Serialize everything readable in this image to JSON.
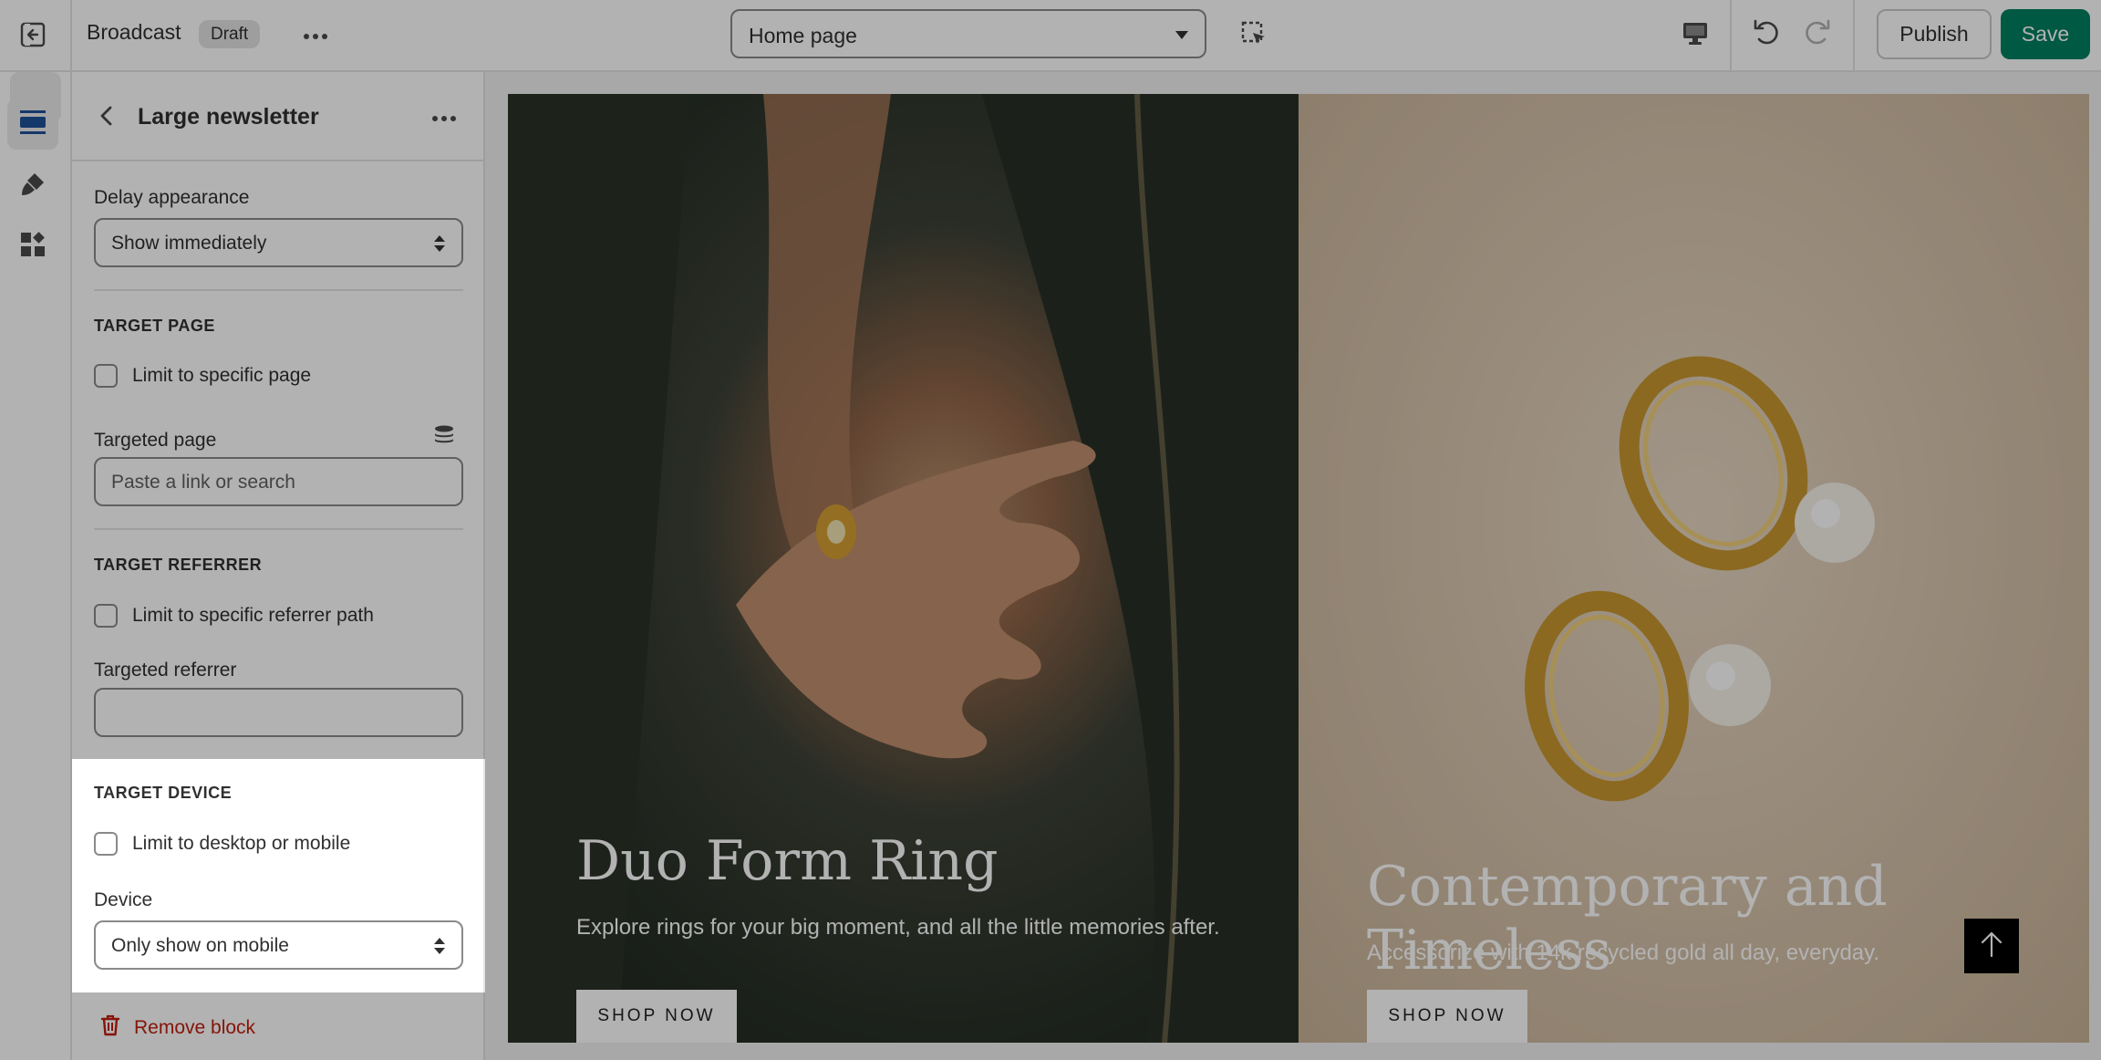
{
  "topbar": {
    "theme_name": "Broadcast",
    "status_badge": "Draft",
    "page_selector": "Home page",
    "publish_label": "Publish",
    "save_label": "Save"
  },
  "panel": {
    "title": "Large newsletter",
    "delay": {
      "label": "Delay appearance",
      "value": "Show immediately"
    },
    "target_page": {
      "heading": "TARGET PAGE",
      "checkbox_label": "Limit to specific page",
      "field_label": "Targeted page",
      "placeholder": "Paste a link or search"
    },
    "target_referrer": {
      "heading": "TARGET REFERRER",
      "checkbox_label": "Limit to specific referrer path",
      "field_label": "Targeted referrer",
      "value": ""
    },
    "target_device": {
      "heading": "TARGET DEVICE",
      "checkbox_label": "Limit to desktop or mobile",
      "field_label": "Device",
      "value": "Only show on mobile"
    },
    "remove_label": "Remove block"
  },
  "preview": {
    "left": {
      "title": "Duo Form Ring",
      "subtitle": "Explore rings for your big moment, and all the little memories after.",
      "button": "SHOP NOW"
    },
    "right": {
      "title": "Contemporary and Timeless",
      "subtitle": "Accessorize with 14k recycled gold all day, everyday.",
      "button": "SHOP NOW"
    }
  },
  "colors": {
    "save_bg": "#008060",
    "remove_text": "#c01e0d",
    "active_rail": "#1f5199"
  },
  "icons": [
    "exit-icon",
    "more-horizontal-icon",
    "inspect-select-icon",
    "desktop-icon",
    "undo-icon",
    "redo-icon",
    "sections-icon",
    "theme-settings-icon",
    "app-blocks-icon",
    "back-arrow-icon",
    "dynamic-source-icon",
    "trash-icon",
    "arrow-up-icon"
  ]
}
